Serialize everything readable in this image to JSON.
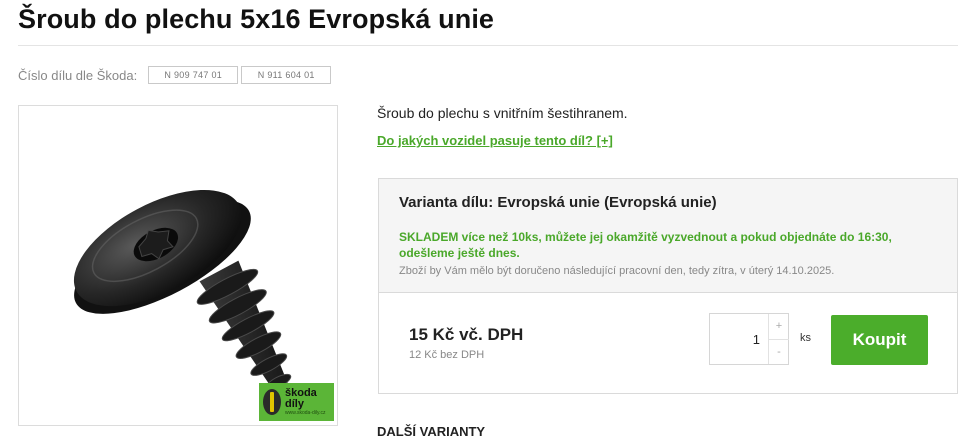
{
  "page": {
    "title": "Šroub do plechu 5x16 Evropská unie",
    "part_number_label": "Číslo dílu dle Škoda:",
    "part_numbers": [
      "N 909 747 01",
      "N 911 604 01"
    ],
    "description": "Šroub do plechu s vnitřním šestihranem.",
    "fit_link": "Do jakých vozidel pasuje tento díl? [+]",
    "more_variants_heading": "DALŠÍ VARIANTY"
  },
  "brand_badge": {
    "line1": "škoda",
    "line2": "díly",
    "line3": "www.skoda-dily.cz",
    "color": "#5bb537"
  },
  "variant": {
    "title": "Varianta dílu: Evropská unie (Evropská unie)",
    "stock_text": "SKLADEM více než 10ks, můžete jej okamžitě vyzvednout a pokud objednáte do 16:30, odešleme ještě dnes.",
    "delivery_text": "Zboží by Vám mělo být doručeno následující pracovní den, tedy zítra, v úterý 14.10.2025.",
    "price_gross": "15 Kč vč. DPH",
    "price_net": "12 Kč bez DPH",
    "quantity": "1",
    "increment": "+",
    "decrement": "-",
    "unit": "ks",
    "buy_label": "Koupit"
  },
  "colors": {
    "accent_green": "#4bad2b",
    "link_green": "#4aa82a",
    "panel_bg": "#f5f5f5"
  }
}
